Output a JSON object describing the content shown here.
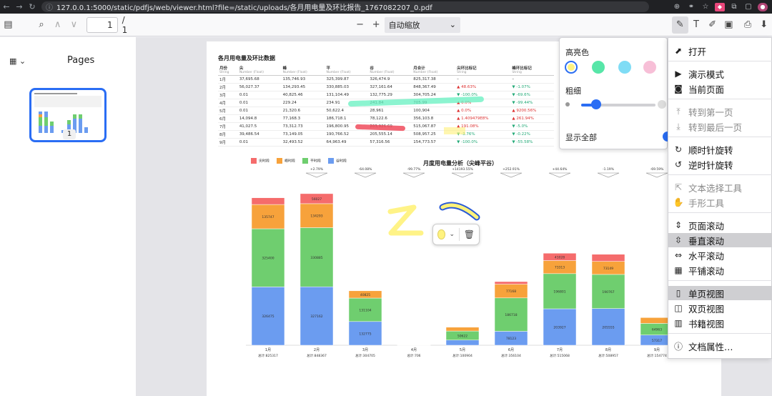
{
  "browser": {
    "url": "127.0.0.1:5000/static/pdfjs/web/viewer.html?file=/static/uploads/各月用电量及环比报告_1767082207_0.pdf"
  },
  "toolbar": {
    "page_number": "1",
    "page_total": "/ 1",
    "zoom": "自动缩放"
  },
  "sidebar": {
    "title": "Pages",
    "thumb_label": "1"
  },
  "document": {
    "title": "各月用电量及环比数据",
    "table": {
      "headers": [
        {
          "name": "月份",
          "type": "String"
        },
        {
          "name": "尖",
          "type": "Number (Float)"
        },
        {
          "name": "峰",
          "type": "Number (Float)"
        },
        {
          "name": "平",
          "type": "Number (Float)"
        },
        {
          "name": "谷",
          "type": "Number (Float)"
        },
        {
          "name": "月合计",
          "type": "Number (Float)"
        },
        {
          "name": "尖环比标记",
          "type": "String"
        },
        {
          "name": "峰环比标记",
          "type": "String"
        }
      ],
      "rows": [
        [
          "1月",
          "37,695.68",
          "135,746.93",
          "325,399.87",
          "326,474.9",
          "825,317.38",
          "–",
          "–"
        ],
        [
          "2月",
          "56,027.37",
          "134,293.45",
          "330,885.03",
          "327,161.64",
          "848,367.49",
          "▲ 48.63%",
          "▼ -1.07%"
        ],
        [
          "3月",
          "0.01",
          "40,825.46",
          "131,104.49",
          "132,775.29",
          "304,705.24",
          "▼ -100.0%",
          "▼ -69.6%"
        ],
        [
          "4月",
          "0.01",
          "229.24",
          "234.91",
          "241.84",
          "705.99",
          "▲ 0.0%",
          "▼ -99.44%"
        ],
        [
          "5月",
          "0.01",
          "21,320.6",
          "50,622.4",
          "28,961",
          "100,904",
          "▲ 0.0%",
          "▲ 9200.56%"
        ],
        [
          "6月",
          "14,094.8",
          "77,168.3",
          "186,718.1",
          "78,122.6",
          "356,103.8",
          "▲ 1.409479E8%",
          "▲ 261.94%"
        ],
        [
          "7月",
          "41,027.5",
          "73,312.73",
          "196,800.95",
          "203,926.69",
          "515,067.87",
          "▲ 191.08%",
          "▼ -5.0%"
        ],
        [
          "8月",
          "39,486.54",
          "73,149.05",
          "190,766.52",
          "205,555.14",
          "508,957.25",
          "▼ -3.76%",
          "▼ -0.22%"
        ],
        [
          "9月",
          "0.01",
          "32,493.52",
          "64,963.49",
          "57,316.56",
          "154,773.57",
          "▼ -100.0%",
          "▼ -55.58%"
        ]
      ]
    }
  },
  "chart_data": {
    "type": "bar",
    "title": "月度用电量分析（尖峰平谷）",
    "legend": [
      "尖时段",
      "峰时段",
      "平时段",
      "谷时段"
    ],
    "categories": [
      "1月",
      "2月",
      "3月",
      "4月",
      "5月",
      "6月",
      "7月",
      "8月",
      "9月"
    ],
    "totals_labels": [
      "总计:825317",
      "总计:848367",
      "总计:304705",
      "总计:706",
      "总计:100904",
      "总计:356104",
      "总计:515068",
      "总计:508957",
      "总计:154774"
    ],
    "series": [
      {
        "name": "谷时段",
        "values": [
          326475,
          327162,
          132775,
          242,
          28961,
          78123,
          203927,
          205555,
          57317
        ]
      },
      {
        "name": "平时段",
        "values": [
          325400,
          330885,
          131104,
          235,
          50622,
          186718,
          196801,
          190767,
          64963
        ]
      },
      {
        "name": "峰时段",
        "values": [
          135747,
          134293,
          40825,
          229,
          21321,
          77168,
          73313,
          73149,
          32494
        ]
      },
      {
        "name": "尖时段",
        "values": [
          37696,
          56027,
          0,
          0,
          0,
          14095,
          41028,
          39487,
          0
        ]
      }
    ],
    "top_labels": [
      "",
      "+2.79%",
      "-64.08%",
      "-99.77%",
      "+14193.55%",
      "+252.91%",
      "+44.64%",
      "-1.19%",
      "-69.59%"
    ],
    "legend_colors": {
      "尖时段": "#f56c6c",
      "峰时段": "#f7a23b",
      "平时段": "#6fce6f",
      "谷时段": "#6b9cf0"
    }
  },
  "annotation_popup": {
    "color": "#fff380"
  },
  "highlight_panel": {
    "color_label": "高亮色",
    "thickness_label": "粗细",
    "show_all_label": "显示全部",
    "swatches": [
      "#fff380",
      "#57e6a8",
      "#7fdcf5",
      "#f7bfd7"
    ],
    "thickness_value": 0.2
  },
  "tools_menu": {
    "items": [
      {
        "icon": "open-icon",
        "glyph": "⬈",
        "label": "打开"
      },
      {
        "icon": "presentation-icon",
        "glyph": "▶",
        "label": "演示模式"
      },
      {
        "icon": "current-page-icon",
        "glyph": "◙",
        "label": "当前页面"
      },
      {
        "icon": "first-page-icon",
        "glyph": "⤒",
        "label": "转到第一页"
      },
      {
        "icon": "last-page-icon",
        "glyph": "⤓",
        "label": "转到最后一页"
      },
      {
        "icon": "rotate-cw-icon",
        "glyph": "↻",
        "label": "顺时针旋转"
      },
      {
        "icon": "rotate-ccw-icon",
        "glyph": "↺",
        "label": "逆时针旋转"
      },
      {
        "icon": "text-select-icon",
        "glyph": "⇱",
        "label": "文本选择工具"
      },
      {
        "icon": "hand-tool-icon",
        "glyph": "✋",
        "label": "手形工具"
      },
      {
        "icon": "page-scroll-icon",
        "glyph": "⇕",
        "label": "页面滚动"
      },
      {
        "icon": "vertical-scroll-icon",
        "glyph": "⇳",
        "label": "垂直滚动"
      },
      {
        "icon": "horizontal-scroll-icon",
        "glyph": "⇔",
        "label": "水平滚动"
      },
      {
        "icon": "wrapped-scroll-icon",
        "glyph": "▦",
        "label": "平铺滚动"
      },
      {
        "icon": "single-page-icon",
        "glyph": "▯",
        "label": "单页视图"
      },
      {
        "icon": "double-page-icon",
        "glyph": "◫",
        "label": "双页视图"
      },
      {
        "icon": "book-view-icon",
        "glyph": "▥",
        "label": "书籍视图"
      },
      {
        "icon": "doc-properties-icon",
        "glyph": "ⓘ",
        "label": "文档属性…"
      }
    ]
  }
}
